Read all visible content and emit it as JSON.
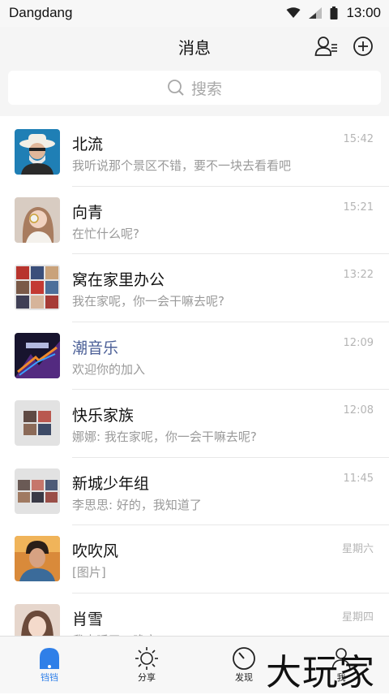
{
  "status_bar": {
    "carrier": "Dangdang",
    "time": "13:00"
  },
  "header": {
    "title": "消息"
  },
  "search": {
    "placeholder": "搜索"
  },
  "conversations": [
    {
      "name": "北流",
      "preview": "我听说那个景区不错，要不一块去看看吧",
      "time": "15:42",
      "highlight": false
    },
    {
      "name": "向青",
      "preview": "在忙什么呢?",
      "time": "15:21",
      "highlight": false
    },
    {
      "name": "窝在家里办公",
      "preview": "我在家呢，你一会干嘛去呢?",
      "time": "13:22",
      "highlight": false
    },
    {
      "name": "潮音乐",
      "preview": "欢迎你的加入",
      "time": "12:09",
      "highlight": true
    },
    {
      "name": "快乐家族",
      "preview": "娜娜: 我在家呢，你一会干嘛去呢?",
      "time": "12:08",
      "highlight": false
    },
    {
      "name": "新城少年组",
      "preview": "李思思: 好的，我知道了",
      "time": "11:45",
      "highlight": false
    },
    {
      "name": "吹吹风",
      "preview": "[图片]",
      "time": "星期六",
      "highlight": false
    },
    {
      "name": "肖雪",
      "preview": "我去睡了，晚安",
      "time": "星期四",
      "highlight": false
    }
  ],
  "tabs": [
    {
      "label": "铛铛",
      "icon": "chat-bubble-icon",
      "active": true
    },
    {
      "label": "分享",
      "icon": "sun-icon",
      "active": false
    },
    {
      "label": "发现",
      "icon": "compass-icon",
      "active": false
    },
    {
      "label": "我",
      "icon": "person-icon",
      "active": false
    }
  ],
  "watermark": {
    "text": "大玩家"
  },
  "colors": {
    "accent": "#2f7fe8",
    "highlight_name": "#4a5e96"
  }
}
